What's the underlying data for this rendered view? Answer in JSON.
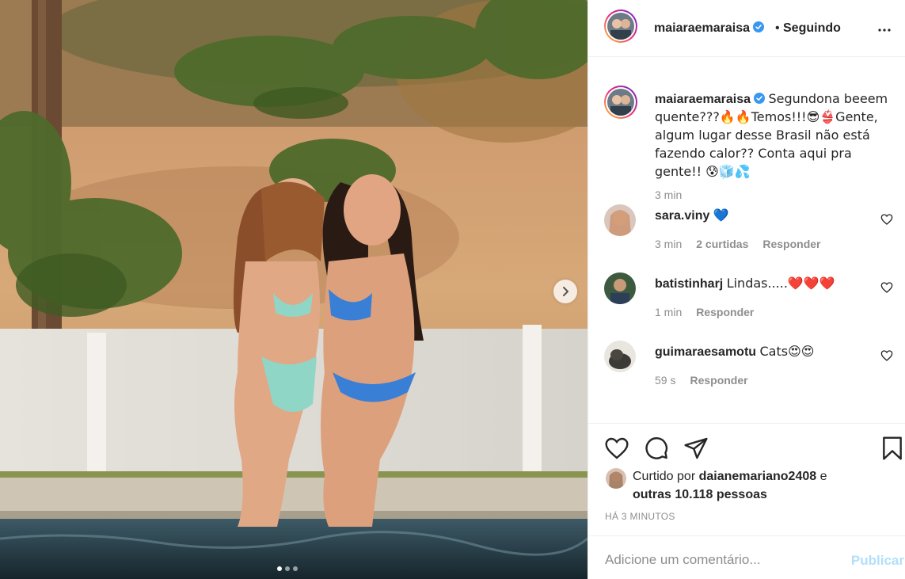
{
  "post": {
    "username": "maiaraemaraisa",
    "follow_state": "Seguindo",
    "separator": "•"
  },
  "caption": {
    "username": "maiaraemaraisa",
    "text": "Segundona beeem quente???🔥🔥Temos!!!😎👙Gente, algum lugar desse Brasil não está fazendo calor?? Conta aqui pra gente!! 😰🧊💦",
    "time": "3 min"
  },
  "comments": [
    {
      "username": "sara.viny",
      "text": "💙",
      "time": "3 min",
      "likes": "2 curtidas",
      "reply": "Responder"
    },
    {
      "username": "batistinharj",
      "text": "Lindas.....❤️❤️❤️",
      "time": "1 min",
      "likes": "",
      "reply": "Responder"
    },
    {
      "username": "guimaraesamotu",
      "text": "Cats😍😍",
      "time": "59 s",
      "likes": "",
      "reply": "Responder"
    }
  ],
  "liked_by": {
    "prefix": "Curtido por",
    "user": "daianemariano2408",
    "conjunction": "e",
    "others": "outras 10.118 pessoas"
  },
  "time_ago": "HÁ 3 MINUTOS",
  "add_comment": {
    "placeholder": "Adicione um comentário...",
    "publish_label": "Publicar"
  },
  "carousel": {
    "total_slides": 3,
    "active_slide": 1
  },
  "icons": {
    "heart": "heart-icon",
    "comment": "comment-icon",
    "share": "share-icon",
    "save": "bookmark-icon",
    "more": "more-options-icon",
    "next": "chevron-right-icon",
    "verified": "verified-badge-icon"
  },
  "colors": {
    "verified_blue": "#3897f0",
    "publish_disabled": "#b2dffc",
    "meta_gray": "#8e8e8e"
  }
}
